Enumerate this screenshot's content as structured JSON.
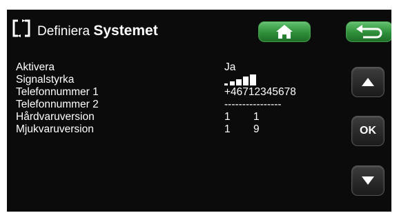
{
  "header": {
    "title_part1": "Definiera ",
    "title_part2": "Systemet",
    "app_icon": "fullscreen-brackets-icon",
    "home_icon": "home-icon",
    "back_icon": "back-arrow-icon"
  },
  "colors": {
    "background": "#0b0b0b",
    "text": "#ffffff",
    "green_button": "#2f8f3a"
  },
  "rows": [
    {
      "label": "Aktivera",
      "value": "Ja"
    },
    {
      "label": "Signalstyrka",
      "signal_bars_filled": 5,
      "signal_bars_total": 5
    },
    {
      "label": "Telefonnummer 1",
      "value": "+46712345678"
    },
    {
      "label": "Telefonnummer 2",
      "value": "----------------"
    },
    {
      "label": "Hårdvaruversion",
      "value": "1",
      "value2": "1"
    },
    {
      "label": "Mjukvaruversion",
      "value": "1",
      "value2": "9"
    }
  ],
  "side_buttons": {
    "up_icon": "arrow-up-icon",
    "ok_label": "OK",
    "down_icon": "arrow-down-icon"
  }
}
